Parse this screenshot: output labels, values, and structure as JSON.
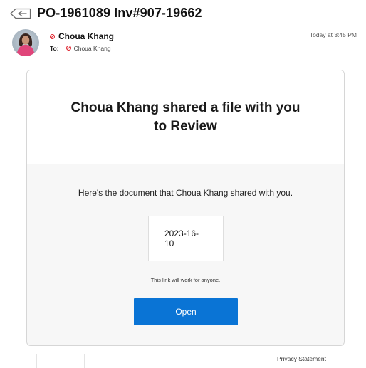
{
  "email": {
    "subject": "PO-1961089 Inv#907-19662",
    "sender": {
      "name": "Choua Khang",
      "to_label": "To:",
      "to_name": "Choua Khang",
      "timestamp": "Today at 3:45 PM"
    },
    "card": {
      "title": "Choua Khang shared a file with you to Review",
      "description": "Here's the document that Choua Khang shared with you.",
      "document_name": "2023-16-10",
      "link_note": "This link will work for anyone.",
      "open_label": "Open"
    },
    "footer": {
      "privacy_label": "Privacy Statement"
    }
  },
  "icons": {
    "subject_icon": "tag-arrow-icon",
    "warning_icon": "blocked-sender-icon"
  },
  "colors": {
    "accent": "#0a74d5",
    "warning": "#e0303a"
  }
}
